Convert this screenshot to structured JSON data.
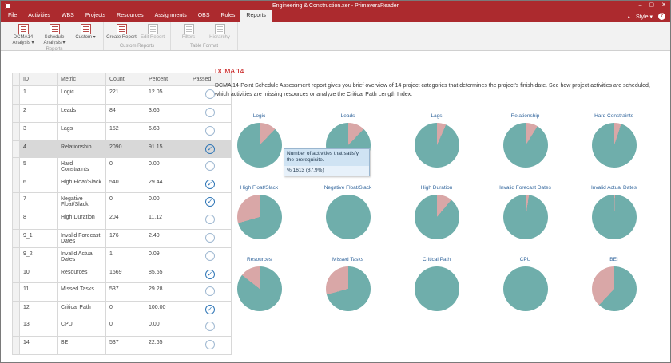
{
  "window": {
    "title": "Engineering & Construction.xer - PrimaveraReader"
  },
  "icons": {
    "check": "✓",
    "caret_down": "▾",
    "collapse": "▴",
    "help": "?",
    "minimize": "–",
    "maximize": "▢",
    "close": "✕"
  },
  "colors": {
    "brand_red": "#AC2A2E",
    "report_title_red": "#C00000",
    "passed_blue": "#2E75B6",
    "pie_label_blue": "#31659C"
  },
  "menubar": {
    "tabs": [
      {
        "label": "File",
        "active": false
      },
      {
        "label": "Activities",
        "active": false
      },
      {
        "label": "WBS",
        "active": false
      },
      {
        "label": "Projects",
        "active": false
      },
      {
        "label": "Resources",
        "active": false
      },
      {
        "label": "Assignments",
        "active": false
      },
      {
        "label": "OBS",
        "active": false
      },
      {
        "label": "Roles",
        "active": false
      },
      {
        "label": "Reports",
        "active": true
      }
    ],
    "right": {
      "style_label": "Style"
    }
  },
  "ribbon": {
    "groups": [
      {
        "label": "Reports",
        "buttons": [
          {
            "label": "DCMA14 Analysis",
            "dropdown": true,
            "disabled": false,
            "icon": "dcma14-analysis-icon"
          },
          {
            "label": "Schedule Analysis",
            "dropdown": true,
            "disabled": false,
            "icon": "schedule-analysis-icon"
          },
          {
            "label": "Custom",
            "dropdown": true,
            "disabled": false,
            "icon": "custom-report-icon"
          }
        ]
      },
      {
        "label": "Custom Reports",
        "buttons": [
          {
            "label": "Create Report",
            "dropdown": false,
            "disabled": false,
            "icon": "create-report-icon"
          },
          {
            "label": "Edit Report",
            "dropdown": false,
            "disabled": true,
            "icon": "edit-report-icon"
          }
        ]
      },
      {
        "label": "Table Format",
        "buttons": [
          {
            "label": "Filters",
            "dropdown": false,
            "disabled": true,
            "icon": "filters-icon"
          },
          {
            "label": "Hierarchy",
            "dropdown": false,
            "disabled": true,
            "icon": "hierarchy-icon"
          }
        ]
      }
    ]
  },
  "table": {
    "headers": [
      "ID",
      "Metric",
      "Count",
      "Percent",
      "Passed"
    ],
    "rows": [
      {
        "id": "1",
        "metric": "Logic",
        "count": "221",
        "percent": "12.05",
        "passed": false,
        "selected": false
      },
      {
        "id": "2",
        "metric": "Leads",
        "count": "84",
        "percent": "3.66",
        "passed": false,
        "selected": false
      },
      {
        "id": "3",
        "metric": "Lags",
        "count": "152",
        "percent": "6.63",
        "passed": false,
        "selected": false
      },
      {
        "id": "4",
        "metric": "Relationship",
        "count": "2090",
        "percent": "91.15",
        "passed": true,
        "selected": true
      },
      {
        "id": "5",
        "metric": "Hard Constraints",
        "count": "0",
        "percent": "0.00",
        "passed": false,
        "selected": false
      },
      {
        "id": "6",
        "metric": "High Float/Slack",
        "count": "540",
        "percent": "29.44",
        "passed": true,
        "selected": false
      },
      {
        "id": "7",
        "metric": "Negative Float/Slack",
        "count": "0",
        "percent": "0.00",
        "passed": true,
        "selected": false
      },
      {
        "id": "8",
        "metric": "High Duration",
        "count": "204",
        "percent": "11.12",
        "passed": false,
        "selected": false
      },
      {
        "id": "9_1",
        "metric": "Invalid Forecast Dates",
        "count": "176",
        "percent": "2.40",
        "passed": false,
        "selected": false
      },
      {
        "id": "9_2",
        "metric": "Invalid Actual Dates",
        "count": "1",
        "percent": "0.09",
        "passed": false,
        "selected": false
      },
      {
        "id": "10",
        "metric": "Resources",
        "count": "1569",
        "percent": "85.55",
        "passed": true,
        "selected": false
      },
      {
        "id": "11",
        "metric": "Missed Tasks",
        "count": "537",
        "percent": "29.28",
        "passed": false,
        "selected": false
      },
      {
        "id": "12",
        "metric": "Critical Path",
        "count": "0",
        "percent": "100.00",
        "passed": true,
        "selected": false
      },
      {
        "id": "13",
        "metric": "CPU",
        "count": "0",
        "percent": "0.00",
        "passed": false,
        "selected": false
      },
      {
        "id": "14",
        "metric": "BEI",
        "count": "537",
        "percent": "22.65",
        "passed": false,
        "selected": false
      }
    ]
  },
  "report": {
    "title": "DCMA 14",
    "description": "DCMA 14-Point Schedule Assessment report gives you brief overview of 14 project categories that determines the project's finish date. See how project activities are scheduled, which activities are missing resources or analyze the Critical Path Length Index."
  },
  "tooltip": {
    "line1": "Number of activities that satisfy the prerequisite.",
    "line2": "% 1613 (87.9%)"
  },
  "chart_data": {
    "type": "pie",
    "legend_position": "none",
    "colors": {
      "remaining_teal": "#6FAEAB",
      "flagged_pink": "#D9A7A7"
    },
    "charts": [
      {
        "label": "Logic",
        "flagged_percent": 12.1,
        "remaining_percent": 87.9,
        "start_deg": 0
      },
      {
        "label": "Leads",
        "flagged_percent": 12.1,
        "remaining_percent": 87.9,
        "start_deg": 0,
        "tooltip": true
      },
      {
        "label": "Lags",
        "flagged_percent": 6.6,
        "remaining_percent": 93.4,
        "start_deg": 0
      },
      {
        "label": "Relationship",
        "flagged_percent": 8.9,
        "remaining_percent": 91.1,
        "start_deg": 0
      },
      {
        "label": "Hard Constraints",
        "flagged_percent": 5.0,
        "remaining_percent": 95.0,
        "start_deg": 0
      },
      {
        "label": "High Float/Slack",
        "flagged_percent": 29.4,
        "remaining_percent": 70.6,
        "start_deg": -106
      },
      {
        "label": "Negative Float/Slack",
        "flagged_percent": 0.0,
        "remaining_percent": 100.0,
        "start_deg": 0
      },
      {
        "label": "High Duration",
        "flagged_percent": 11.1,
        "remaining_percent": 88.9,
        "start_deg": 0
      },
      {
        "label": "Invalid Forecast Dates",
        "flagged_percent": 2.4,
        "remaining_percent": 97.6,
        "start_deg": 0
      },
      {
        "label": "Invalid Actual Dates",
        "flagged_percent": 0.5,
        "remaining_percent": 99.5,
        "start_deg": 0
      },
      {
        "label": "Resources",
        "flagged_percent": 14.5,
        "remaining_percent": 85.5,
        "start_deg": -52
      },
      {
        "label": "Missed Tasks",
        "flagged_percent": 29.3,
        "remaining_percent": 70.7,
        "start_deg": -105
      },
      {
        "label": "Critical Path",
        "flagged_percent": 0.0,
        "remaining_percent": 100.0,
        "start_deg": 0
      },
      {
        "label": "CPU",
        "flagged_percent": 0.0,
        "remaining_percent": 100.0,
        "start_deg": 0
      },
      {
        "label": "BEI",
        "flagged_percent": 38.0,
        "remaining_percent": 62.0,
        "start_deg": -137
      }
    ]
  }
}
